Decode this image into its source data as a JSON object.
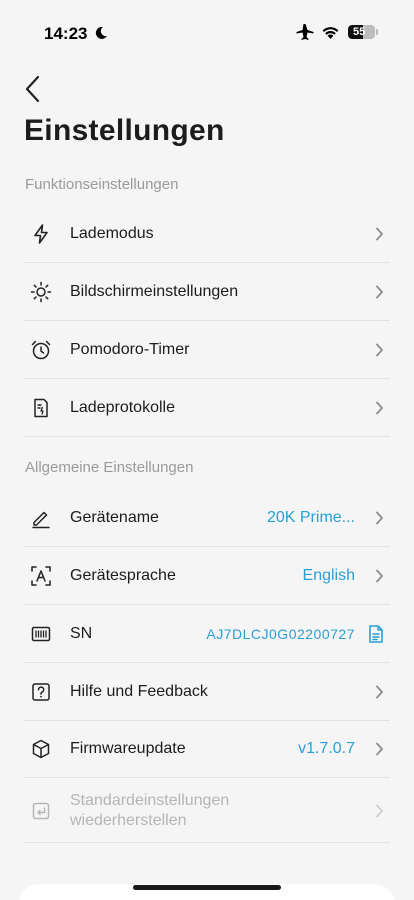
{
  "status_bar": {
    "time": "14:23",
    "battery": "55",
    "battery_level": 0.55
  },
  "header": {
    "title": "Einstellungen"
  },
  "sections": {
    "function": {
      "title": "Funktionseinstellungen",
      "items": [
        {
          "label": "Lademodus",
          "icon": "lightning-icon"
        },
        {
          "label": "Bildschirmeinstellungen",
          "icon": "brightness-icon"
        },
        {
          "label": "Pomodoro-Timer",
          "icon": "alarm-clock-icon"
        },
        {
          "label": "Ladeprotokolle",
          "icon": "log-document-icon"
        }
      ]
    },
    "general": {
      "title": "Allgemeine Einstellungen",
      "items": [
        {
          "label": "Gerätename",
          "value": "20K Prime...",
          "icon": "edit-pen-icon"
        },
        {
          "label": "Gerätesprache",
          "value": "English",
          "icon": "language-icon"
        },
        {
          "label": "SN",
          "value": "AJ7DLCJ0G02200727",
          "icon": "barcode-icon"
        },
        {
          "label": "Hilfe und Feedback",
          "icon": "help-icon"
        },
        {
          "label": "Firmwareupdate",
          "value": "v1.7.0.7",
          "icon": "package-cube-icon"
        },
        {
          "label": "Standardeinstellungen\nwiederherstellen",
          "icon": "restore-icon"
        }
      ]
    }
  },
  "colors": {
    "accent": "#2a9fd6",
    "background": "#f5f5f5",
    "muted": "#9a9a9a"
  }
}
